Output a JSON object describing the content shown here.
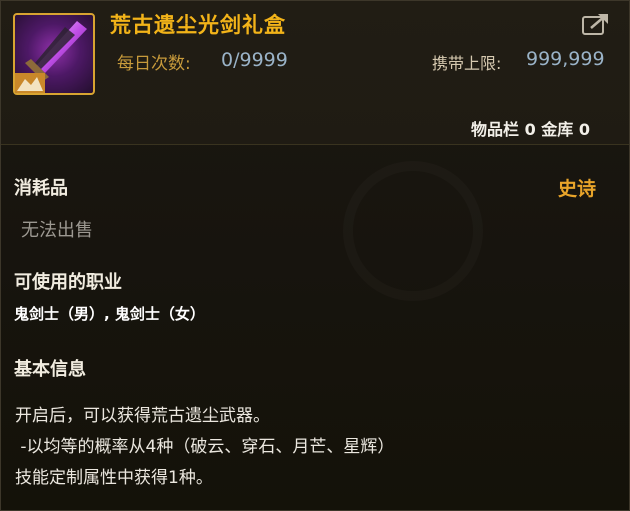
{
  "item": {
    "name": "荒古遗尘光剑礼盒",
    "icon": "sword-giftbox-icon",
    "daily_label": "每日次数:",
    "daily_value": "0/9999",
    "carry_label": "携带上限:",
    "carry_value": "999,999",
    "storage": "物品栏 0 金库 0",
    "category": "消耗品",
    "rarity": "史诗",
    "sell_status": "无法出售",
    "usable_classes_label": "可使用的职业",
    "usable_classes": "鬼剑士（男）, 鬼剑士（女）",
    "basic_info_label": "基本信息",
    "description": [
      "开启后，可以获得荒古遗尘武器。",
      " -以均等的概率从4种（破云、穿石、月芒、星辉）",
      "技能定制属性中获得1种。"
    ]
  },
  "colors": {
    "title": "#f2b319",
    "rarity_epic": "#e8a42a",
    "value_blue": "#9ab3c8",
    "icon_border": "#d8a431"
  },
  "icons": {
    "share": "share-icon",
    "item": "sword-giftbox-icon"
  }
}
